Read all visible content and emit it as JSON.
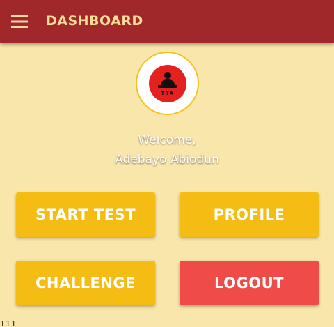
{
  "app_bar": {
    "title": "DASHBOARD",
    "menu_icon": "hamburger-menu-icon",
    "background": "#a0282a",
    "title_color": "#f9dc98"
  },
  "avatar": {
    "logo_text": "TTA",
    "icon": "user-at-desk-logo"
  },
  "welcome": {
    "greeting": "Welcome,",
    "name": "Adebayo Abiodun"
  },
  "buttons": {
    "start_test": "START TEST",
    "profile": "PROFILE",
    "challenge": "CHALLENGE",
    "logout": "LOGOUT"
  },
  "colors": {
    "background": "#f9e6ab",
    "primary_button": "#f5bd14",
    "logout_button": "#ef4b48"
  },
  "peek_text": "111"
}
